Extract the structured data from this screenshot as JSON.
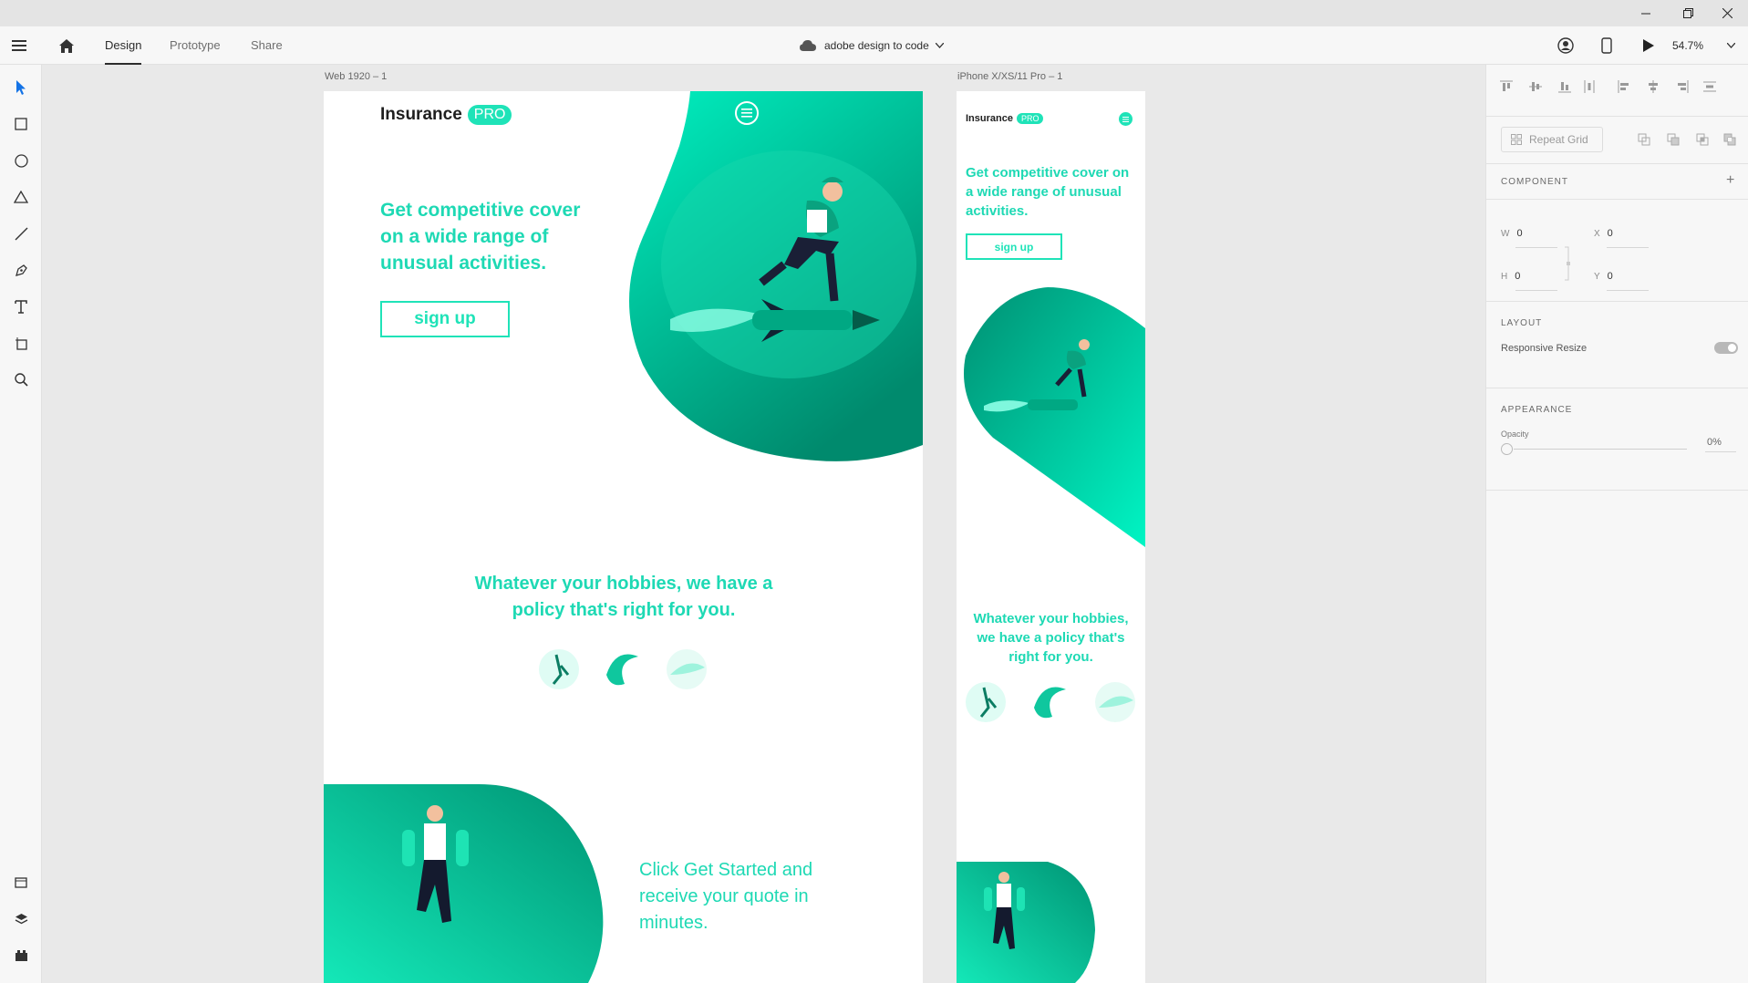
{
  "window": {
    "controls": [
      "minimize-icon",
      "restore-icon",
      "close-icon"
    ]
  },
  "appbar": {
    "tabs": [
      {
        "label": "Design",
        "active": true
      },
      {
        "label": "Prototype",
        "active": false
      },
      {
        "label": "Share",
        "active": false
      }
    ],
    "document_title": "adobe design to code",
    "zoom": "54.7%"
  },
  "tools": [
    "select-tool",
    "rectangle-tool",
    "ellipse-tool",
    "polygon-tool",
    "line-tool",
    "pen-tool",
    "text-tool",
    "artboard-tool",
    "zoom-tool"
  ],
  "bottom_tools": [
    "assets-panel",
    "layers-panel",
    "plugins-panel"
  ],
  "artboards": {
    "web": {
      "label": "Web 1920 – 1",
      "brand": "Insurance",
      "pro_badge": "PRO",
      "hero_text": "Get competitive cover on a wide range of unusual activities.",
      "signup": "sign up",
      "hobby_text": "Whatever your hobbies, we have a policy that's right for you.",
      "quote_text": "Click Get Started and receive your quote in minutes."
    },
    "iphone": {
      "label": "iPhone X/XS/11 Pro – 1",
      "brand": "Insurance",
      "pro_badge": "PRO",
      "hero_text": "Get competitive cover on a wide range of unusual activities.",
      "signup": "sign up",
      "hobby_text": "Whatever your hobbies, we have a policy that's right for you."
    }
  },
  "colors": {
    "accent": "#1fe3b8",
    "accent_dark": "#008f72",
    "accent_light": "#00f5c4"
  },
  "properties": {
    "repeat_grid": "Repeat Grid",
    "component": {
      "title": "COMPONENT"
    },
    "transform": {
      "w": "0",
      "h": "0",
      "x": "0",
      "y": "0",
      "w_label": "W",
      "h_label": "H",
      "x_label": "X",
      "y_label": "Y"
    },
    "layout": {
      "title": "LAYOUT",
      "responsive_resize": "Responsive Resize"
    },
    "appearance": {
      "title": "APPEARANCE",
      "opacity_label": "Opacity",
      "opacity_value": "0%"
    }
  }
}
